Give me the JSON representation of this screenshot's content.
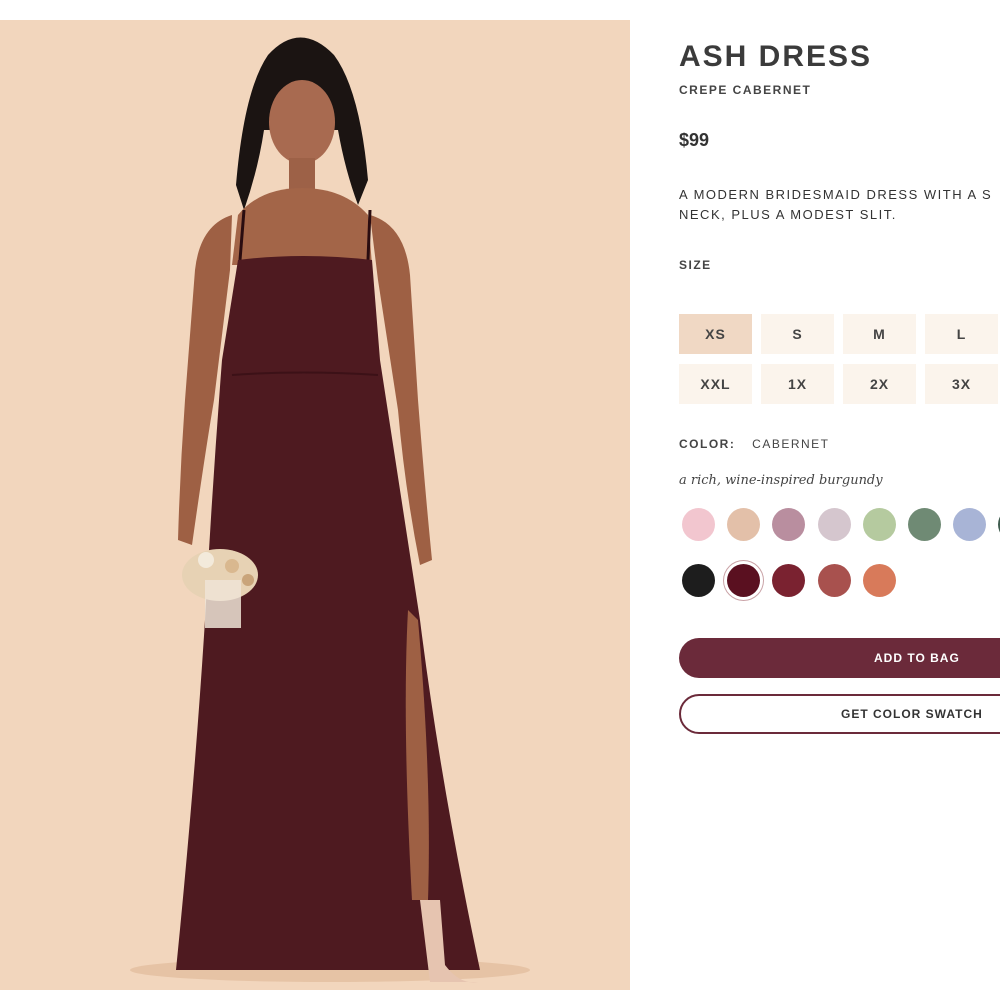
{
  "product": {
    "title": "ASH DRESS",
    "subtitle": "CREPE CABERNET",
    "price": "$99",
    "description_line1": "A MODERN BRIDESMAID DRESS WITH A S",
    "description_line2": "NECK, PLUS A MODEST SLIT."
  },
  "size": {
    "label": "SIZE",
    "options": [
      "XS",
      "S",
      "M",
      "L",
      "XXL",
      "1X",
      "2X",
      "3X"
    ],
    "selected": "XS"
  },
  "color": {
    "label": "COLOR:",
    "value": "CABERNET",
    "description": "a rich, wine-inspired burgundy",
    "swatches": [
      {
        "name": "swatch-light-pink",
        "color": "#f2c6cf"
      },
      {
        "name": "swatch-champagne",
        "color": "#e3c0a9"
      },
      {
        "name": "swatch-mauve",
        "color": "#b98e9f"
      },
      {
        "name": "swatch-lilac",
        "color": "#d5c6ce"
      },
      {
        "name": "swatch-sage",
        "color": "#b5ca9f"
      },
      {
        "name": "swatch-eucalyptus",
        "color": "#6f8a74"
      },
      {
        "name": "swatch-periwinkle",
        "color": "#a8b4d6"
      },
      {
        "name": "swatch-forest",
        "color": "#3f5c4e"
      },
      {
        "name": "swatch-black",
        "color": "#1d1d1d"
      },
      {
        "name": "swatch-cabernet",
        "color": "#5a1020"
      },
      {
        "name": "swatch-burgundy",
        "color": "#7a2230"
      },
      {
        "name": "swatch-rose",
        "color": "#a8514e"
      },
      {
        "name": "swatch-terracotta",
        "color": "#d87a5a"
      }
    ],
    "selected_index": 9
  },
  "actions": {
    "add_to_bag": "ADD TO BAG",
    "get_swatch": "GET COLOR SWATCH"
  },
  "colors": {
    "accent": "#6b2a3a",
    "photo_background": "#f2d6bd",
    "dress": "#4e1a20",
    "size_selected": "#f0d8c4",
    "size_default": "#fbf4ec"
  }
}
